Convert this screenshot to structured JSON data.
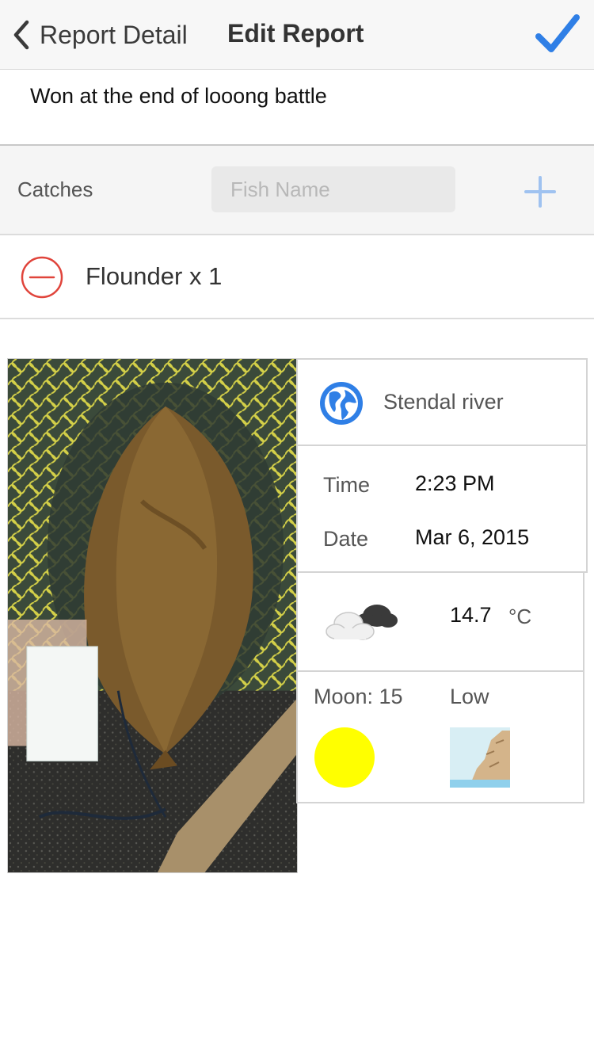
{
  "navbar": {
    "back_label": "Report Detail",
    "title": "Edit Report"
  },
  "note": {
    "text": "Won at the end of looong battle"
  },
  "catches": {
    "label": "Catches",
    "fish_input_placeholder": "Fish Name",
    "items": [
      {
        "text": "Flounder x 1"
      }
    ]
  },
  "location": {
    "name": "Stendal river"
  },
  "datetime": {
    "time_label": "Time",
    "time_value": "2:23 PM",
    "date_label": "Date",
    "date_value": "Mar 6, 2015"
  },
  "weather": {
    "temperature": "14.7",
    "unit": "°C"
  },
  "moon_tide": {
    "moon_label": "Moon: 15",
    "tide_label": "Low"
  },
  "colors": {
    "accent": "#2f7fe6",
    "remove_red": "#e0443b",
    "moon_yellow": "#ffff00"
  },
  "icons": [
    "chevron-left-icon",
    "checkmark-icon",
    "plus-icon",
    "minus-circle-icon",
    "globe-icon",
    "cloud-icon"
  ]
}
